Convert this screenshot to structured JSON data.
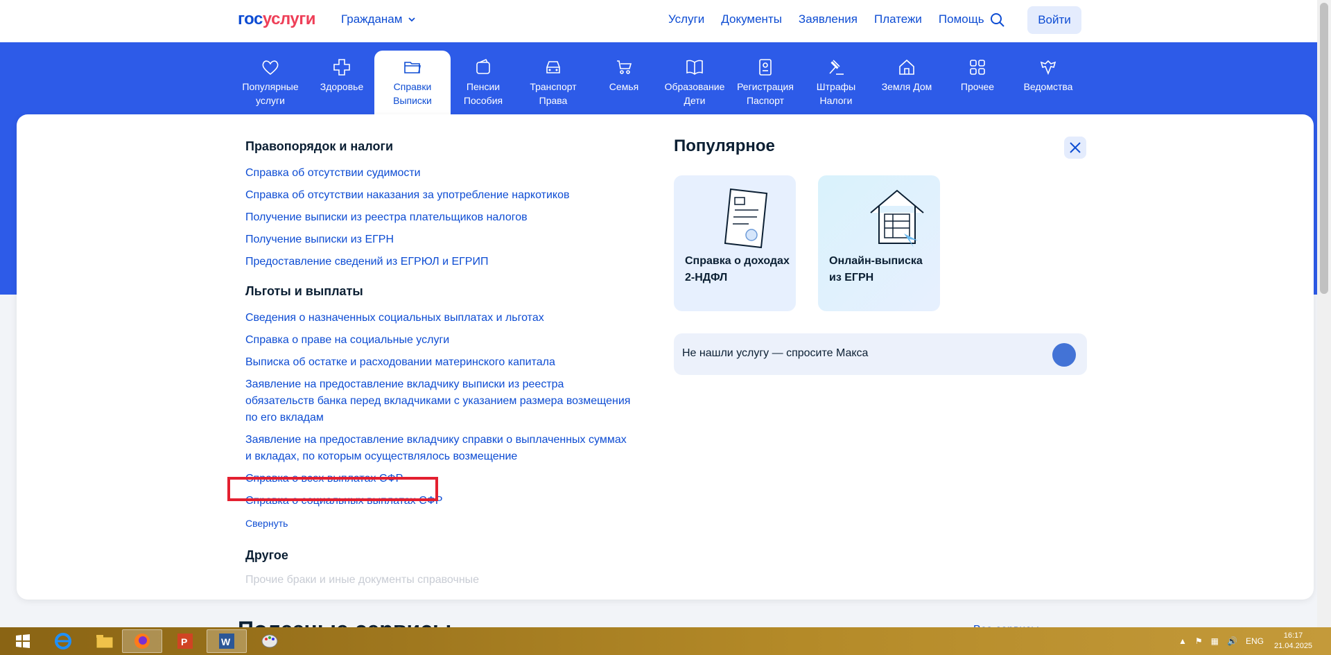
{
  "header": {
    "logo_part1": "гос",
    "logo_part2": "услуги",
    "citizens": "Гражданам",
    "nav": [
      "Услуги",
      "Документы",
      "Заявления",
      "Платежи",
      "Помощь"
    ],
    "login": "Войти"
  },
  "categories": [
    {
      "line1": "Популярные",
      "line2": "услуги",
      "icon": "heart-icon"
    },
    {
      "line1": "Здоровье",
      "line2": "",
      "icon": "plus-icon"
    },
    {
      "line1": "Справки",
      "line2": "Выписки",
      "icon": "folder-icon"
    },
    {
      "line1": "Пенсии",
      "line2": "Пособия",
      "icon": "wallet-icon"
    },
    {
      "line1": "Транспорт",
      "line2": "Права",
      "icon": "car-icon"
    },
    {
      "line1": "Семья",
      "line2": "",
      "icon": "stroller-icon"
    },
    {
      "line1": "Образование",
      "line2": "Дети",
      "icon": "book-icon"
    },
    {
      "line1": "Регистрация",
      "line2": "Паспорт",
      "icon": "passport-icon"
    },
    {
      "line1": "Штрафы",
      "line2": "Налоги",
      "icon": "gavel-icon"
    },
    {
      "line1": "Земля Дом",
      "line2": "",
      "icon": "house-icon"
    },
    {
      "line1": "Прочее",
      "line2": "",
      "icon": "grid-icon"
    },
    {
      "line1": "Ведомства",
      "line2": "",
      "icon": "emblem-icon"
    }
  ],
  "groups": {
    "law": {
      "title": "Правопорядок и налоги",
      "links": [
        "Справка об отсутствии судимости",
        "Справка об отсутствии наказания за употребление наркотиков",
        "Получение выписки из реестра плательщиков налогов",
        "Получение выписки из ЕГРН",
        "Предоставление сведений из ЕГРЮЛ и ЕГРИП"
      ]
    },
    "benefits": {
      "title": "Льготы и выплаты",
      "links": [
        "Сведения о назначенных социальных выплатах и льготах",
        "Справка о праве на социальные услуги",
        "Выписка об остатке и расходовании материнского капитала",
        "Заявление на предоставление вкладчику выписки из реестра обязательств банка перед вкладчиками с указанием размера возмещения по его вкладам",
        "Заявление на предоставление вкладчику справки о выплаченных суммах и вкладах, по которым осуществлялось возмещение",
        "Справка о всех выплатах СФР",
        "Справка о социальных выплатах СФР"
      ],
      "collapse": "Свернуть"
    },
    "other": {
      "title": "Другое",
      "faded_item": "Прочие браки и иные документы справочные"
    }
  },
  "popular": {
    "title": "Популярное",
    "card1": {
      "line1": "Справка о доходах",
      "line2": "2-НДФЛ"
    },
    "card2": {
      "line1": "Онлайн-выписка",
      "line2": "из ЕГРН"
    },
    "ask": "Не нашли услугу — спросите Макса"
  },
  "below": {
    "title": "Полезные сервисы",
    "link": "Все сервисы"
  },
  "taskbar": {
    "lang": "ENG",
    "time": "16:17",
    "date": "21.04.2025"
  },
  "colors": {
    "brand_blue": "#0d4cd3",
    "band_blue": "#2d5be8",
    "logo_red": "#ee3f58",
    "highlight_red": "#e32030"
  }
}
